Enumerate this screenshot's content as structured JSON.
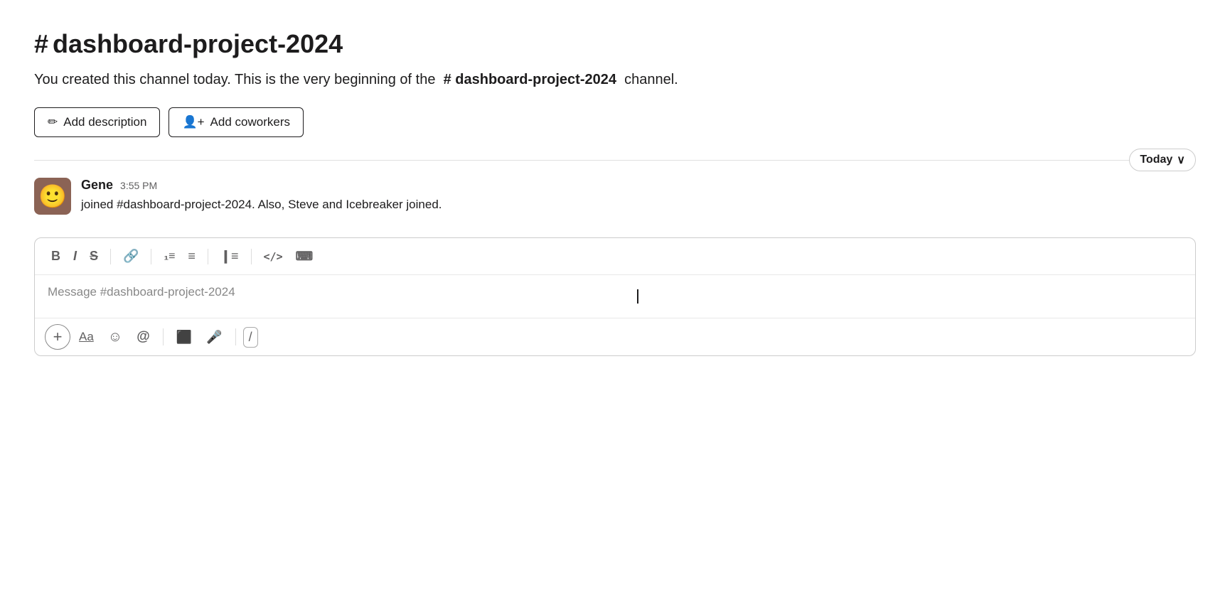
{
  "channel": {
    "title": "dashboard-project-2024",
    "hash_symbol": "#",
    "description_prefix": "You created this channel today. This is the very beginning of the",
    "description_channel_name": "# dashboard-project-2024",
    "description_suffix": "channel."
  },
  "buttons": {
    "add_description": "Add description",
    "add_coworkers": "Add coworkers"
  },
  "divider": {
    "today_label": "Today",
    "chevron": "∨"
  },
  "message": {
    "author": "Gene",
    "time": "3:55 PM",
    "body": "joined #dashboard-project-2024. Also, Steve and Icebreaker joined."
  },
  "composer": {
    "placeholder": "Message #dashboard-project-2024",
    "toolbar": {
      "bold": "B",
      "italic": "I",
      "strikethrough": "S",
      "link": "🔗",
      "ordered_list": "₁≡",
      "unordered_list": "≡",
      "block_quote": "❙≡",
      "code": "</>",
      "code_block": "⌨"
    },
    "bottom_toolbar": {
      "plus": "+",
      "font": "Aa",
      "emoji": "☺",
      "mention": "@",
      "video": "🎥",
      "mic": "🎤",
      "slash": "/"
    }
  }
}
